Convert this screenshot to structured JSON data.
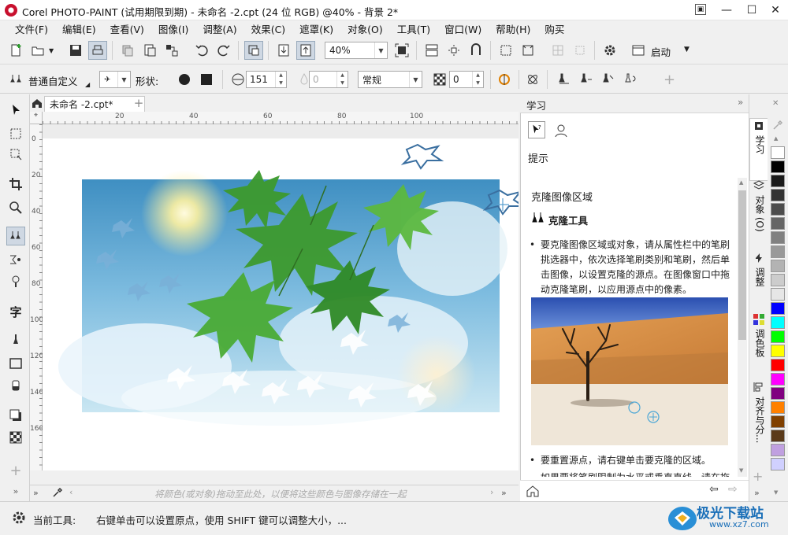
{
  "window": {
    "title": "Corel PHOTO-PAINT (试用期限到期) - 未命名 -2.cpt (24 位 RGB) @40% - 背景 2*",
    "minimize": "—",
    "maximize": "☐",
    "close": "✕"
  },
  "menu": [
    "文件(F)",
    "编辑(E)",
    "查看(V)",
    "图像(I)",
    "调整(A)",
    "效果(C)",
    "遮罩(K)",
    "对象(O)",
    "工具(T)",
    "窗口(W)",
    "帮助(H)",
    "购买"
  ],
  "toolbar": {
    "zoom_value": "40%",
    "launch_label": "启动"
  },
  "propbar": {
    "brush_name": "普通自定义",
    "shape_label": "形状:",
    "size_value": "151",
    "transparency_value": "0",
    "blend_mode": "常规",
    "feather_value": "0"
  },
  "document": {
    "tab_label": "未命名 -2.cpt*",
    "ruler_h_ticks": [
      "20",
      "40",
      "60",
      "80",
      "100"
    ],
    "ruler_v_ticks": [
      "0",
      "20",
      "40",
      "60",
      "80",
      "100",
      "120",
      "140",
      "160"
    ]
  },
  "colorwell": {
    "hint": "将颜色(或对象)拖动至此处，以便将这些颜色与图像存储在一起"
  },
  "docker": {
    "title": "学习",
    "tips_label": "提示",
    "heading": "克隆图像区域",
    "tool_name": "克隆工具",
    "paragraph1": "要克隆图像区域或对象，请从属性栏中的笔刷挑选器中，依次选择笔刷类别和笔刷，然后单击图像，以设置克隆的源点。在图像窗口中拖动克隆笔刷，以应用源点中的像素。",
    "paragraph2": "要重置源点，请右键单击要克隆的区域。",
    "paragraph3": "如果要将笔刷限制为水平或垂直直线，请在拖"
  },
  "right_tabs": [
    "学习",
    "对象 (O)",
    "调整",
    "调色板",
    "对齐与分..."
  ],
  "palette_colors": [
    "#ffffff",
    "#000000",
    "#1a1a1a",
    "#333333",
    "#4d4d4d",
    "#666666",
    "#808080",
    "#999999",
    "#b3b3b3",
    "#cccccc",
    "#e6e6e6",
    "#0000ff",
    "#00ffff",
    "#00ff00",
    "#ffff00",
    "#ff0000",
    "#ff00ff",
    "#800080",
    "#ff8000",
    "#804000",
    "#5a3a1a",
    "#c0a0e0",
    "#d0d0ff"
  ],
  "status": {
    "prefix": "当前工具:",
    "message": "右键单击可以设置原点，使用 SHIFT 键可以调整大小，..."
  },
  "watermark": {
    "brand": "极光下载站",
    "url": "www.xz7.com"
  }
}
